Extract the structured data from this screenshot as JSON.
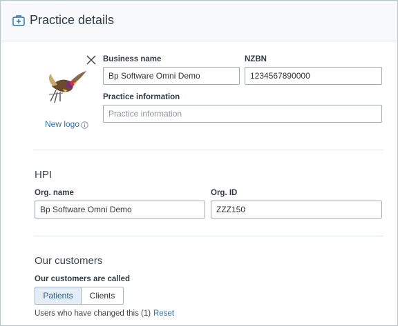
{
  "header": {
    "title": "Practice details",
    "icon": "medical-kit-icon"
  },
  "logo": {
    "new_logo_label": "New logo",
    "remove_icon": "close-icon",
    "info_icon": "info-icon",
    "image": "bird-logo"
  },
  "business": {
    "business_name_label": "Business name",
    "business_name_value": "Bp Software Omni Demo",
    "nzbn_label": "NZBN",
    "nzbn_value": "1234567890000",
    "practice_info_label": "Practice information",
    "practice_info_placeholder": "Practice information"
  },
  "hpi": {
    "section_title": "HPI",
    "org_name_label": "Org. name",
    "org_name_value": "Bp Software Omni Demo",
    "org_id_label": "Org. ID",
    "org_id_value": "ZZZ150"
  },
  "customers": {
    "section_title": "Our customers",
    "called_label": "Our customers are called",
    "options": [
      "Patients",
      "Clients"
    ],
    "selected": "Patients",
    "changed_note": "Users who have changed this (1)",
    "reset_label": "Reset"
  },
  "colors": {
    "accent": "#2673b8",
    "header_bg": "#f7f9fb",
    "divider": "#d8e6ea"
  }
}
